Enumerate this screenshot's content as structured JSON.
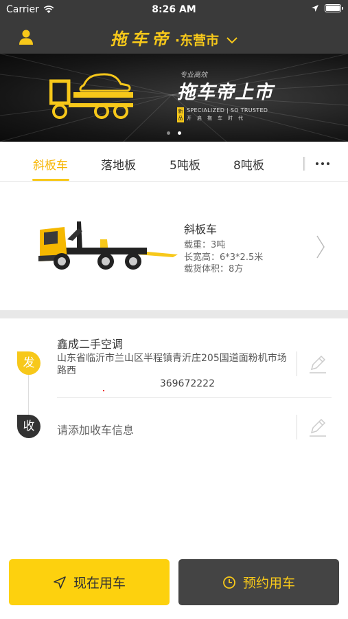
{
  "status_bar": {
    "carrier": "Carrier",
    "time": "8:26 AM"
  },
  "nav": {
    "brand": "拖车帝",
    "city": "·东营市",
    "icons": [
      "user-icon",
      "chevron-down-icon"
    ]
  },
  "banner": {
    "small_text": "专业高效",
    "headline": "拖车帝上市",
    "badge": "新品上市",
    "tagline_en": "SPECIALIZED | SO TRUSTED",
    "tagline_cn": "开启拖车时代",
    "page_count": 2,
    "active_page": 2
  },
  "tabs": [
    {
      "label": "斜板车",
      "active": true
    },
    {
      "label": "落地板",
      "active": false
    },
    {
      "label": "5吨板",
      "active": false
    },
    {
      "label": "8吨板",
      "active": false
    }
  ],
  "vehicle": {
    "name": "斜板车",
    "load": "载重：3吨",
    "dimensions": "长宽高：6*3*2.5米",
    "volume": "载货体积：8方"
  },
  "address": {
    "send_marker": "发",
    "recv_marker": "收",
    "sender_name": "鑫成二手空调",
    "sender_address": "山东省临沂市兰山区半程镇青沂庄205国道面粉机市场路西",
    "sender_phone": "369672222",
    "receiver_placeholder": "请添加收车信息"
  },
  "buttons": {
    "now": "现在用车",
    "book": "预约用车"
  },
  "colors": {
    "accent": "#f7c81a",
    "dark": "#3a3a3a",
    "button_yellow": "#fdd10e",
    "button_dark": "#444444"
  }
}
